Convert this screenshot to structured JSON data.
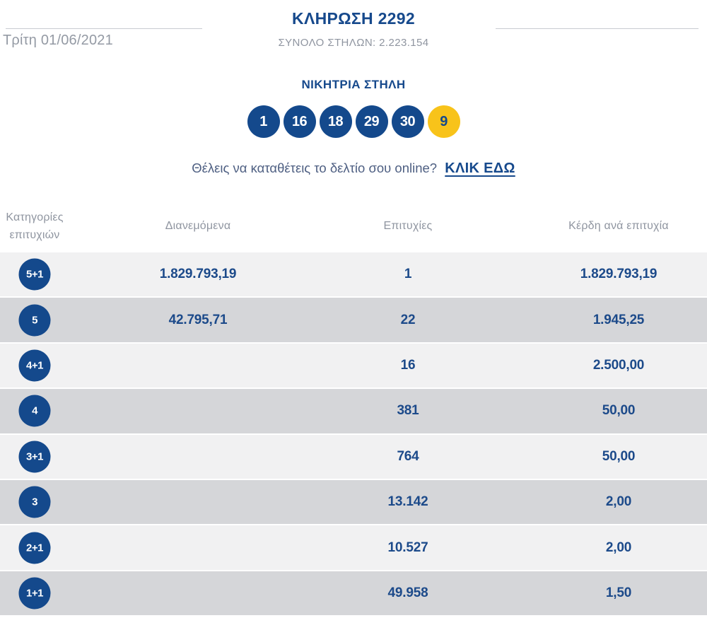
{
  "colors": {
    "navy": "#14498c",
    "bonus_yellow": "#f8c31a",
    "row_light": "#f1f1f2",
    "row_dark": "#d5d6d9",
    "muted_gray": "#8f95a0",
    "promo_blue_gray": "#4e5f82"
  },
  "header": {
    "title": "ΚΛΗΡΩΣΗ 2292",
    "date": "Τρίτη 01/06/2021",
    "total_columns": "ΣΥΝΟΛΟ ΣΤΗΛΩΝ: 2.223.154"
  },
  "winning": {
    "heading": "ΝΙΚΗΤΡΙΑ ΣΤΗΛΗ",
    "numbers": [
      "1",
      "16",
      "18",
      "29",
      "30"
    ],
    "bonus": "9"
  },
  "promo": {
    "text": "Θέλεις να καταθέτεις το δελτίο σου online?",
    "link": "ΚΛΙΚ ΕΔΩ"
  },
  "table": {
    "headers": {
      "category": "Κατηγορίες επιτυχιών",
      "distributed": "Διανεμόμενα",
      "winners": "Επιτυχίες",
      "prize": "Κέρδη ανά επιτυχία"
    },
    "rows": [
      {
        "category": "5+1",
        "distributed": "1.829.793,19",
        "winners": "1",
        "prize": "1.829.793,19"
      },
      {
        "category": "5",
        "distributed": "42.795,71",
        "winners": "22",
        "prize": "1.945,25"
      },
      {
        "category": "4+1",
        "distributed": "",
        "winners": "16",
        "prize": "2.500,00"
      },
      {
        "category": "4",
        "distributed": "",
        "winners": "381",
        "prize": "50,00"
      },
      {
        "category": "3+1",
        "distributed": "",
        "winners": "764",
        "prize": "50,00"
      },
      {
        "category": "3",
        "distributed": "",
        "winners": "13.142",
        "prize": "2,00"
      },
      {
        "category": "2+1",
        "distributed": "",
        "winners": "10.527",
        "prize": "2,00"
      },
      {
        "category": "1+1",
        "distributed": "",
        "winners": "49.958",
        "prize": "1,50"
      }
    ]
  }
}
